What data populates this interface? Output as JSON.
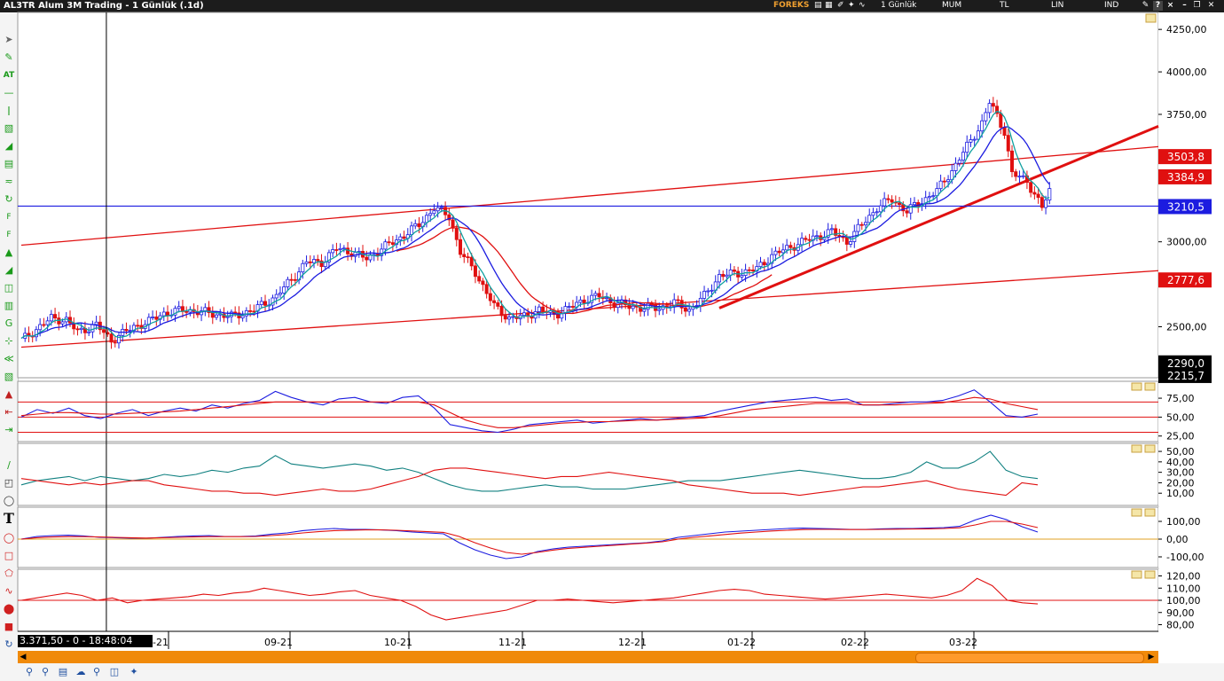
{
  "window": {
    "title": "AL3TR Alum 3M Trading - 1 Günlük (.1d)",
    "toolbar": [
      "FOREKS",
      "1 Günlük",
      "MUM",
      "TL",
      "LIN",
      "IND"
    ]
  },
  "readout": "3.371,50 - 0 - 18:48:04",
  "colors": {
    "up": "#1c1ce0",
    "down": "#e01010",
    "trend": "#e01010",
    "sma_fast": "#10a0a0",
    "sma_slow": "#1c1ce0",
    "hline": "#1c1ce0"
  },
  "chart_data": [
    {
      "type": "candlestick",
      "x_ticks": [
        "-21",
        "09-21",
        "10-21",
        "11-21",
        "12-21",
        "01-22",
        "02-22",
        "03-22"
      ],
      "y_ticks": [
        "4250,00",
        "4000,00",
        "3750,00",
        "3000,00",
        "2500,00"
      ],
      "ylim": [
        2200,
        4350
      ],
      "price_labels": [
        {
          "text": "3503,8",
          "value": 3504,
          "color": "#e01010"
        },
        {
          "text": "3384,9",
          "value": 3385,
          "color": "#e01010"
        },
        {
          "text": "3210,5",
          "value": 3210,
          "color": "#1c1ce0"
        },
        {
          "text": "2777,6",
          "value": 2778,
          "color": "#e01010"
        },
        {
          "text": "2290,0",
          "value": 2290,
          "color": "#000000"
        },
        {
          "text": "2215,7",
          "value": 2216,
          "color": "#000000"
        }
      ],
      "close_path": [
        [
          0,
          2420
        ],
        [
          8,
          2550
        ],
        [
          12,
          2540
        ],
        [
          15,
          2470
        ],
        [
          20,
          2510
        ],
        [
          24,
          2420
        ],
        [
          30,
          2500
        ],
        [
          34,
          2530
        ],
        [
          38,
          2580
        ],
        [
          44,
          2600
        ],
        [
          50,
          2580
        ],
        [
          56,
          2560
        ],
        [
          62,
          2600
        ],
        [
          68,
          2680
        ],
        [
          72,
          2780
        ],
        [
          76,
          2880
        ],
        [
          80,
          2880
        ],
        [
          84,
          2960
        ],
        [
          88,
          2940
        ],
        [
          92,
          2900
        ],
        [
          96,
          2960
        ],
        [
          100,
          3010
        ],
        [
          106,
          3100
        ],
        [
          110,
          3200
        ],
        [
          114,
          3150
        ],
        [
          117,
          2940
        ],
        [
          121,
          2820
        ],
        [
          126,
          2620
        ],
        [
          130,
          2550
        ],
        [
          134,
          2560
        ],
        [
          138,
          2600
        ],
        [
          142,
          2570
        ],
        [
          146,
          2610
        ],
        [
          150,
          2660
        ],
        [
          154,
          2680
        ],
        [
          158,
          2640
        ],
        [
          162,
          2620
        ],
        [
          166,
          2610
        ],
        [
          170,
          2610
        ],
        [
          174,
          2640
        ],
        [
          178,
          2600
        ],
        [
          182,
          2680
        ],
        [
          186,
          2800
        ],
        [
          192,
          2820
        ],
        [
          196,
          2840
        ],
        [
          200,
          2920
        ],
        [
          204,
          2960
        ],
        [
          208,
          3000
        ],
        [
          212,
          3030
        ],
        [
          216,
          3060
        ],
        [
          220,
          3000
        ],
        [
          224,
          3100
        ],
        [
          228,
          3200
        ],
        [
          232,
          3250
        ],
        [
          236,
          3180
        ],
        [
          240,
          3240
        ],
        [
          244,
          3300
        ],
        [
          248,
          3420
        ],
        [
          252,
          3560
        ],
        [
          256,
          3700
        ],
        [
          258,
          3820
        ],
        [
          260,
          3740
        ],
        [
          262,
          3650
        ],
        [
          264,
          3400
        ],
        [
          266,
          3380
        ],
        [
          268,
          3360
        ],
        [
          270,
          3280
        ],
        [
          272,
          3200
        ],
        [
          274,
          3300
        ]
      ],
      "n": 274,
      "trendlines": [
        {
          "x1": 0,
          "y1": 2980,
          "x2": 303,
          "y2": 3560
        },
        {
          "x1": 0,
          "y1": 2380,
          "x2": 303,
          "y2": 2830
        },
        {
          "x1": 186,
          "y1": 2610,
          "x2": 303,
          "y2": 3680
        }
      ],
      "hline": 3210,
      "vline_x": 17
    },
    {
      "type": "line",
      "y_ticks": [
        "75,00",
        "50,00",
        "25,00"
      ],
      "ylim": [
        20,
        95
      ],
      "hlines": [
        70,
        50,
        30
      ],
      "series": [
        {
          "color": "#1c1ce0",
          "values": [
            50,
            60,
            55,
            62,
            52,
            48,
            55,
            60,
            52,
            58,
            62,
            58,
            66,
            62,
            68,
            72,
            84,
            76,
            70,
            66,
            74,
            76,
            70,
            68,
            76,
            78,
            62,
            40,
            36,
            32,
            30,
            34,
            40,
            42,
            44,
            46,
            42,
            44,
            46,
            48,
            46,
            48,
            50,
            52,
            58,
            62,
            66,
            70,
            72,
            74,
            76,
            72,
            74,
            66,
            66,
            68,
            70,
            70,
            72,
            78,
            86,
            70,
            52,
            50,
            54
          ]
        },
        {
          "color": "#e01010",
          "values": [
            52,
            54,
            56,
            56,
            55,
            54,
            54,
            55,
            56,
            57,
            58,
            60,
            62,
            64,
            66,
            68,
            70,
            70,
            70,
            70,
            70,
            70,
            70,
            70,
            70,
            70,
            66,
            56,
            46,
            40,
            36,
            36,
            38,
            40,
            42,
            43,
            44,
            44,
            45,
            46,
            46,
            47,
            48,
            49,
            52,
            56,
            60,
            62,
            64,
            66,
            68,
            68,
            68,
            66,
            66,
            66,
            67,
            68,
            69,
            72,
            76,
            74,
            68,
            64,
            60
          ]
        }
      ]
    },
    {
      "type": "line",
      "y_ticks": [
        "50,00",
        "40,00",
        "30,00",
        "20,00",
        "10,00"
      ],
      "ylim": [
        0,
        56
      ],
      "series": [
        {
          "color": "#108080",
          "values": [
            18,
            22,
            24,
            26,
            22,
            26,
            24,
            22,
            24,
            28,
            26,
            28,
            32,
            30,
            34,
            36,
            46,
            38,
            36,
            34,
            36,
            38,
            36,
            32,
            34,
            30,
            24,
            18,
            14,
            12,
            12,
            14,
            16,
            18,
            16,
            16,
            14,
            14,
            14,
            16,
            18,
            20,
            22,
            22,
            22,
            24,
            26,
            28,
            30,
            32,
            30,
            28,
            26,
            24,
            24,
            26,
            30,
            40,
            34,
            34,
            40,
            50,
            32,
            26,
            24
          ]
        },
        {
          "color": "#e01010",
          "values": [
            24,
            22,
            20,
            18,
            20,
            18,
            20,
            22,
            22,
            18,
            16,
            14,
            12,
            12,
            10,
            10,
            8,
            10,
            12,
            14,
            12,
            12,
            14,
            18,
            22,
            26,
            32,
            34,
            34,
            32,
            30,
            28,
            26,
            24,
            26,
            26,
            28,
            30,
            28,
            26,
            24,
            22,
            18,
            16,
            14,
            12,
            10,
            10,
            10,
            8,
            10,
            12,
            14,
            16,
            16,
            18,
            20,
            22,
            18,
            14,
            12,
            10,
            8,
            20,
            18
          ]
        }
      ]
    },
    {
      "type": "line",
      "y_ticks": [
        "100,00",
        "0,00",
        "-100,00"
      ],
      "ylim": [
        -150,
        170
      ],
      "hlines": [
        0
      ],
      "series": [
        {
          "color": "#1c1ce0",
          "values": [
            0,
            15,
            20,
            22,
            18,
            10,
            8,
            5,
            5,
            10,
            15,
            18,
            20,
            15,
            15,
            18,
            28,
            35,
            48,
            55,
            60,
            55,
            55,
            52,
            48,
            40,
            35,
            30,
            -20,
            -60,
            -90,
            -110,
            -100,
            -70,
            -55,
            -45,
            -40,
            -35,
            -30,
            -25,
            -20,
            -10,
            10,
            20,
            30,
            40,
            45,
            50,
            55,
            60,
            62,
            60,
            58,
            55,
            55,
            58,
            60,
            60,
            62,
            65,
            72,
            108,
            135,
            110,
            70,
            40
          ]
        },
        {
          "color": "#e01010",
          "values": [
            0,
            8,
            12,
            14,
            14,
            12,
            10,
            8,
            6,
            8,
            10,
            12,
            14,
            14,
            14,
            15,
            20,
            26,
            35,
            42,
            48,
            50,
            52,
            52,
            50,
            46,
            42,
            38,
            15,
            -20,
            -50,
            -75,
            -85,
            -75,
            -62,
            -52,
            -46,
            -40,
            -34,
            -28,
            -22,
            -15,
            0,
            10,
            18,
            26,
            34,
            40,
            46,
            50,
            54,
            55,
            55,
            54,
            54,
            55,
            56,
            57,
            58,
            60,
            64,
            80,
            100,
            100,
            85,
            65
          ]
        }
      ]
    },
    {
      "type": "line",
      "y_ticks": [
        "120,00",
        "110,00",
        "100,00",
        "90,00",
        "80,00"
      ],
      "ylim": [
        76,
        124
      ],
      "hlines": [
        100
      ],
      "series": [
        {
          "color": "#e01010",
          "values": [
            100,
            102,
            104,
            106,
            104,
            100,
            102,
            98,
            100,
            101,
            102,
            103,
            105,
            104,
            106,
            107,
            110,
            108,
            106,
            104,
            105,
            107,
            108,
            104,
            102,
            100,
            95,
            88,
            84,
            86,
            88,
            90,
            92,
            96,
            100,
            100,
            101,
            100,
            99,
            98,
            99,
            100,
            101,
            102,
            104,
            106,
            108,
            109,
            108,
            105,
            104,
            103,
            102,
            101,
            102,
            103,
            104,
            105,
            104,
            103,
            102,
            104,
            108,
            118,
            112,
            100,
            98,
            97
          ]
        }
      ]
    }
  ]
}
